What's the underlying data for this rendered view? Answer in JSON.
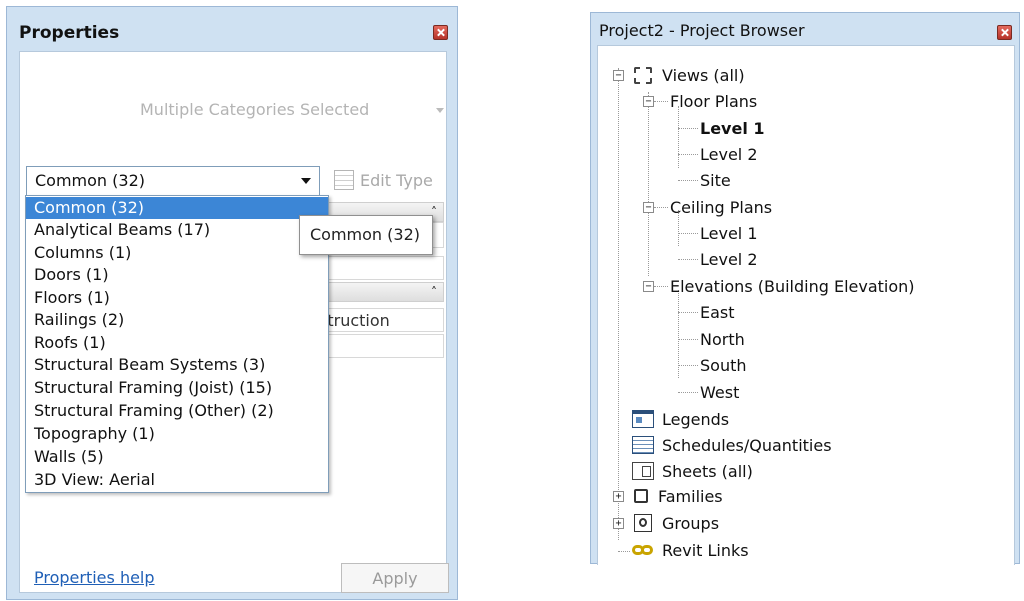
{
  "properties": {
    "title": "Properties",
    "type_selector_text": "Multiple Categories Selected",
    "filter_value": "Common (32)",
    "edit_type_label": "Edit Type",
    "dropdown_items": [
      "Common (32)",
      "Analytical Beams (17)",
      "Columns (1)",
      "Doors (1)",
      "Floors (1)",
      "Railings (2)",
      "Roofs (1)",
      "Structural Beam Systems (3)",
      "Structural Framing (Joist) (15)",
      "Structural Framing (Other) (2)",
      "Topography (1)",
      "Walls (5)",
      "3D View: Aerial"
    ],
    "tooltip_text": "Common (32)",
    "partial_value": "struction",
    "help_link": "Properties help",
    "apply_label": "Apply",
    "collapse_glyph": "˄"
  },
  "browser": {
    "title": "Project2 - Project Browser",
    "root": "Views (all)",
    "floor_plans": {
      "label": "Floor Plans",
      "items": [
        "Level 1",
        "Level 2",
        "Site"
      ]
    },
    "ceiling_plans": {
      "label": "Ceiling Plans",
      "items": [
        "Level 1",
        "Level 2"
      ]
    },
    "elevations": {
      "label": "Elevations (Building Elevation)",
      "items": [
        "East",
        "North",
        "South",
        "West"
      ]
    },
    "legends": "Legends",
    "schedules": "Schedules/Quantities",
    "sheets": "Sheets (all)",
    "families": "Families",
    "groups": "Groups",
    "revit_links": "Revit Links",
    "expand_glyph": "+",
    "collapse_glyph": "−"
  }
}
